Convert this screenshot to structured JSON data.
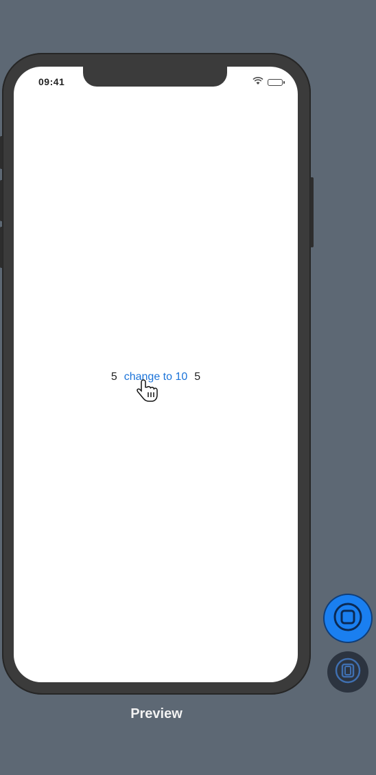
{
  "status_bar": {
    "time": "09:41",
    "icons": [
      "wifi-icon",
      "battery-icon"
    ]
  },
  "content": {
    "left_value": "5",
    "button_label": "change to 10",
    "right_value": "5"
  },
  "controls": {
    "live_preview_icon": "live-preview-icon",
    "device_settings_icon": "device-settings-icon"
  },
  "preview_label": "Preview",
  "colors": {
    "canvas_background": "#5d6874",
    "accent": "#1a7ff0",
    "link": "#1a73d9"
  }
}
